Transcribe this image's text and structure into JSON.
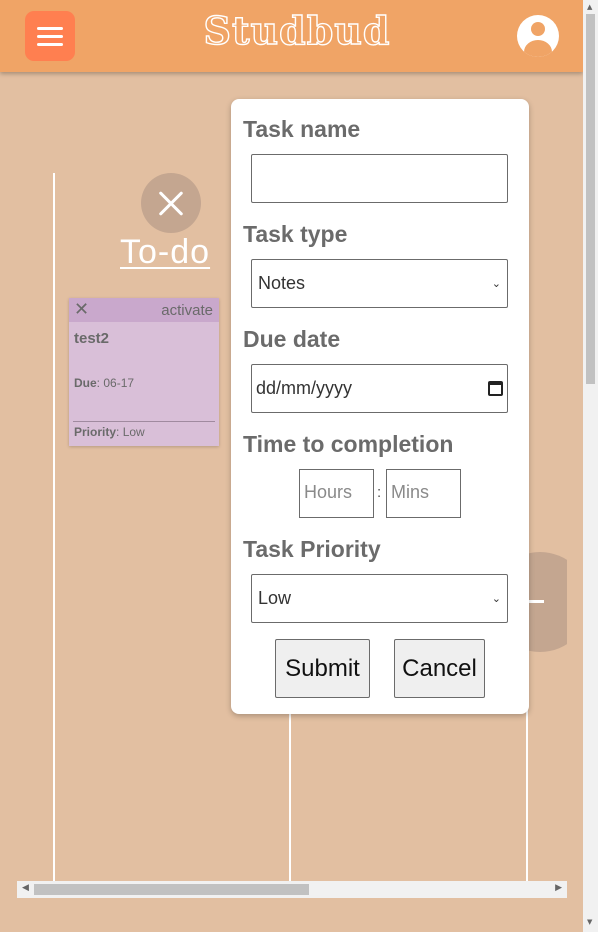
{
  "app": {
    "title": "Studbud"
  },
  "header": {
    "menu_icon": "hamburger-icon",
    "profile_icon": "user-icon"
  },
  "board": {
    "column_title": "To-do",
    "close_icon": "close-icon",
    "cards": [
      {
        "name": "test2",
        "action": "activate",
        "due_label": "Due",
        "due_value": "06-17",
        "priority_label": "Priority",
        "priority_value": "Low"
      }
    ]
  },
  "modal": {
    "task_name": {
      "label": "Task name",
      "value": ""
    },
    "task_type": {
      "label": "Task type",
      "selected": "Notes"
    },
    "due_date": {
      "label": "Due date",
      "placeholder": "dd/mm/yyyy"
    },
    "time": {
      "label": "Time to completion",
      "hours_placeholder": "Hours",
      "separator": ":",
      "mins_placeholder": "Mins"
    },
    "priority": {
      "label": "Task Priority",
      "selected": "Low"
    },
    "submit_label": "Submit",
    "cancel_label": "Cancel"
  },
  "colors": {
    "header": "#f0a466",
    "background": "#e2bfa1",
    "menu_button": "#ff7f50",
    "card": "#d9bfd8"
  }
}
